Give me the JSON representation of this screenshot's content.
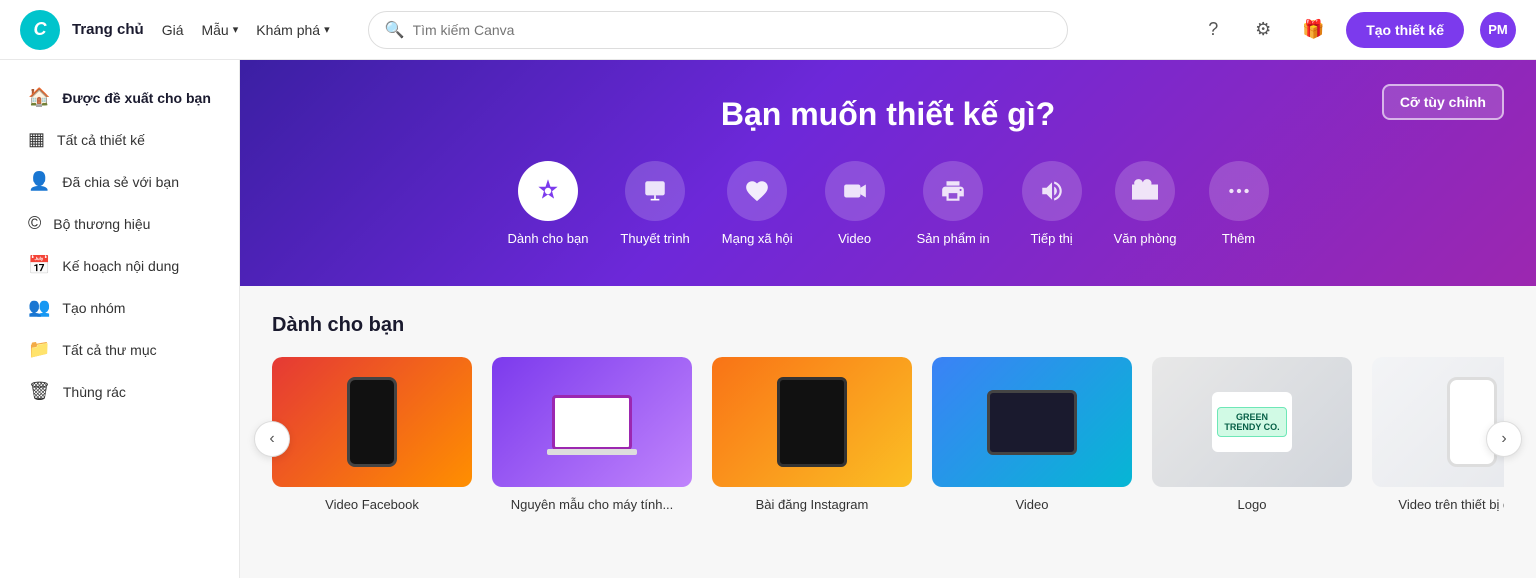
{
  "header": {
    "logo_text": "C",
    "nav_home": "Trang chủ",
    "nav_price": "Giá",
    "nav_templates": "Mẫu",
    "nav_explore": "Khám phá",
    "search_placeholder": "Tìm kiếm Canva",
    "create_btn": "Tạo thiết kế",
    "avatar_initials": "PM"
  },
  "sidebar": {
    "items": [
      {
        "id": "recommended",
        "label": "Được đề xuất cho bạn",
        "icon": "🏠",
        "active": true
      },
      {
        "id": "all-designs",
        "label": "Tất cả thiết kế",
        "icon": "▦"
      },
      {
        "id": "shared",
        "label": "Đã chia sẻ với bạn",
        "icon": "👥"
      },
      {
        "id": "brand",
        "label": "Bộ thương hiệu",
        "icon": "©"
      },
      {
        "id": "content-plan",
        "label": "Kế hoạch nội dung",
        "icon": "📅"
      },
      {
        "id": "teams",
        "label": "Tạo nhóm",
        "icon": "👥"
      },
      {
        "id": "all-folders",
        "label": "Tất cả thư mục",
        "icon": "📁"
      },
      {
        "id": "trash",
        "label": "Thùng rác",
        "icon": "🗑"
      }
    ]
  },
  "hero": {
    "title": "Bạn muốn thiết kế gì?",
    "custom_size_btn": "Cỡ tùy chỉnh",
    "categories": [
      {
        "id": "for-you",
        "label": "Dành cho bạn",
        "icon": "✦",
        "active": true
      },
      {
        "id": "presentation",
        "label": "Thuyết trình",
        "icon": "🖥"
      },
      {
        "id": "social",
        "label": "Mạng xã hội",
        "icon": "❤"
      },
      {
        "id": "video",
        "label": "Video",
        "icon": "▶"
      },
      {
        "id": "print",
        "label": "Sản phẩm in",
        "icon": "🖨"
      },
      {
        "id": "marketing",
        "label": "Tiếp thị",
        "icon": "📢"
      },
      {
        "id": "office",
        "label": "Văn phòng",
        "icon": "💼"
      },
      {
        "id": "more",
        "label": "Thêm",
        "icon": "···"
      }
    ]
  },
  "section_for_you": {
    "title": "Dành cho bạn",
    "cards": [
      {
        "id": "facebook-video",
        "label": "Video Facebook",
        "type": "mock-1"
      },
      {
        "id": "laptop-prototype",
        "label": "Nguyên mẫu cho máy tính...",
        "type": "mock-2"
      },
      {
        "id": "instagram-post",
        "label": "Bài đăng Instagram",
        "type": "mock-3"
      },
      {
        "id": "video",
        "label": "Video",
        "type": "mock-4"
      },
      {
        "id": "logo",
        "label": "Logo",
        "type": "mock-5"
      },
      {
        "id": "mobile-video",
        "label": "Video trên thiết bị di động",
        "type": "mock-6"
      }
    ]
  }
}
